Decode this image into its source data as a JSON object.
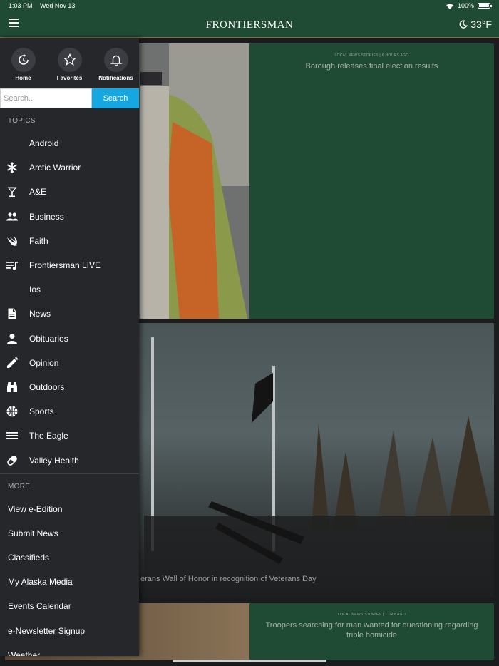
{
  "status": {
    "time": "1:03 PM",
    "date": "Wed Nov 13",
    "battery": "100%"
  },
  "header": {
    "logo": "FRONTIERSMAN",
    "temperature": "33°F"
  },
  "feed": {
    "card1": {
      "kicker": "LOCAL NEWS STORIES | 6 HOURS AGO",
      "headline": "Borough releases final election results"
    },
    "card2": {
      "caption": "erans Wall of Honor in recognition of Veterans Day"
    },
    "card3": {
      "kicker": "LOCAL NEWS STORIES | 1 DAY AGO",
      "headline": "Troopers searching for man wanted for questioning regarding triple homicide"
    }
  },
  "drawer": {
    "quick": [
      {
        "label": "Home",
        "icon": "refresh-icon"
      },
      {
        "label": "Favorites",
        "icon": "star-icon"
      },
      {
        "label": "Notifications",
        "icon": "bell-icon"
      }
    ],
    "search": {
      "placeholder": "Search...",
      "button": "Search"
    },
    "topics_title": "TOPICS",
    "topics": [
      {
        "label": "Android",
        "icon": ""
      },
      {
        "label": "Arctic Warrior",
        "icon": "snowflake-icon"
      },
      {
        "label": "A&E",
        "icon": "cocktail-icon"
      },
      {
        "label": "Business",
        "icon": "people-icon"
      },
      {
        "label": "Faith",
        "icon": "swift-bird-icon"
      },
      {
        "label": "Frontiersman LIVE",
        "icon": "playlist-icon"
      },
      {
        "label": "Ios",
        "icon": ""
      },
      {
        "label": "News",
        "icon": "document-icon"
      },
      {
        "label": "Obituaries",
        "icon": "person-icon"
      },
      {
        "label": "Opinion",
        "icon": "pencil-icon"
      },
      {
        "label": "Outdoors",
        "icon": "binoculars-icon"
      },
      {
        "label": "Sports",
        "icon": "basketball-icon"
      },
      {
        "label": "The Eagle",
        "icon": "menu-lines-icon"
      },
      {
        "label": "Valley Health",
        "icon": "pill-icon"
      }
    ],
    "more_title": "MORE",
    "more": [
      "View e-Edition",
      "Submit News",
      "Classifieds",
      "My Alaska Media",
      "Events Calendar",
      "e-Newsletter Signup",
      "Weather"
    ]
  }
}
